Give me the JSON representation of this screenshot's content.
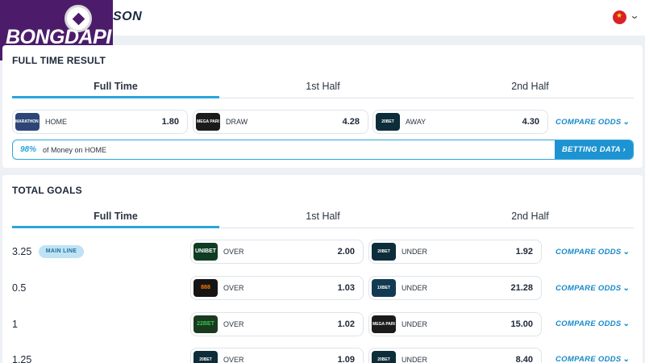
{
  "header": {
    "title_fragment": "SON",
    "logo_text": "BONGDAPI"
  },
  "full_time_result": {
    "title": "FULL TIME RESULT",
    "tabs": [
      {
        "label": "Full Time",
        "active": true
      },
      {
        "label": "1st Half",
        "active": false
      },
      {
        "label": "2nd Half",
        "active": false
      }
    ],
    "odds": [
      {
        "bookmaker": "MARATHON BET",
        "label": "HOME",
        "value": "1.80"
      },
      {
        "bookmaker": "MEGA PARI",
        "label": "DRAW",
        "value": "4.28"
      },
      {
        "bookmaker": "20BET",
        "label": "AWAY",
        "value": "4.30"
      }
    ],
    "compare_label": "COMPARE ODDS",
    "money": {
      "percent": "98%",
      "text": "of Money on HOME"
    },
    "betting_data_label": "BETTING DATA"
  },
  "total_goals": {
    "title": "TOTAL GOALS",
    "tabs": [
      {
        "label": "Full Time",
        "active": true
      },
      {
        "label": "1st Half",
        "active": false
      },
      {
        "label": "2nd Half",
        "active": false
      }
    ],
    "main_line_badge": "MAIN LINE",
    "compare_label": "COMPARE ODDS",
    "rows": [
      {
        "line": "3.25",
        "over": {
          "bookmaker": "UNIBET",
          "label": "OVER",
          "value": "2.00"
        },
        "under": {
          "bookmaker": "20BET",
          "label": "UNDER",
          "value": "1.92"
        }
      },
      {
        "line": "0.5",
        "over": {
          "bookmaker": "888",
          "label": "OVER",
          "value": "1.03"
        },
        "under": {
          "bookmaker": "1XBET",
          "label": "UNDER",
          "value": "21.28"
        }
      },
      {
        "line": "1",
        "over": {
          "bookmaker": "22BET",
          "label": "OVER",
          "value": "1.02"
        },
        "under": {
          "bookmaker": "MEGA PARI",
          "label": "UNDER",
          "value": "15.00"
        }
      },
      {
        "line": "1.25",
        "over": {
          "bookmaker": "20BET",
          "label": "OVER",
          "value": "1.09"
        },
        "under": {
          "bookmaker": "20BET",
          "label": "UNDER",
          "value": "8.40"
        }
      }
    ]
  },
  "colors": {
    "accent": "#2aa5dc",
    "button": "#1d93d1",
    "logo_bg": "#4c1c6b"
  }
}
